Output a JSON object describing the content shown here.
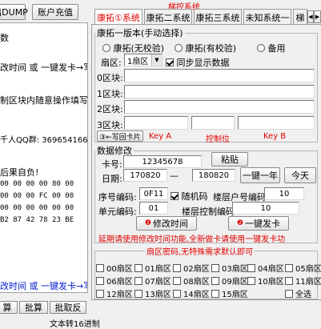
{
  "window": {
    "title": "梯控系统"
  },
  "left_panel": {
    "buttons": {
      "dump": "出DUMP",
      "recharge": "账户充值"
    },
    "lines": [
      "数",
      "改时间 或 一键发卡→写",
      "制区块内随意操作填写,",
      "千人QQ群: 369654166",
      "后果自负!",
      "00 00 00 00 80 00",
      "00 00 00 FC 00 00",
      "00 00 00 00 00 00",
      "B2 87 42 78 23 BE"
    ],
    "bottom_link": "改时间 或 一键发卡→写",
    "bottom_tabs": [
      "算",
      "批算",
      "批取反"
    ],
    "footer_label": "文本转16进制"
  },
  "tabs": [
    {
      "label": "康拓①系统",
      "active": true
    },
    {
      "label": "康拓二系统",
      "active": false
    },
    {
      "label": "康拓三系统",
      "active": false
    },
    {
      "label": "未知系统一",
      "active": false
    },
    {
      "label": "梯",
      "active": false
    }
  ],
  "tab_scroll": {
    "left": "◀",
    "right": "▶"
  },
  "kt_group": {
    "legend": "康拓一版本(手动选择)",
    "radios": [
      {
        "label": "康拓(无校验)",
        "checked": false
      },
      {
        "label": "康拓(有校验)",
        "checked": false
      },
      {
        "label": "备用",
        "checked": false
      }
    ],
    "sector_label": "扇区:",
    "sector_value": "1扇区",
    "sync_label": "同步显示数据",
    "sync_checked": true,
    "blocks": [
      {
        "label": "0区块:",
        "value": ""
      },
      {
        "label": "1区块:",
        "value": ""
      },
      {
        "label": "2区块:",
        "value": ""
      },
      {
        "label": "3区块:",
        "value": ""
      }
    ],
    "write_button": "③←写回卡片",
    "key_a": "Key A",
    "control": "控制位",
    "key_b": "Key B"
  },
  "data_group": {
    "legend": "数据修改",
    "card_label": "卡号:",
    "card_value": "12345678",
    "paste_button": "粘贴",
    "date_label": "日期:",
    "date_from": "170820",
    "date_dash": "—",
    "date_to": "180820",
    "one_year_button": "一键一年",
    "today_button": "今天",
    "seq_label": "序号编码:",
    "seq_value": "0F11",
    "random_label": "随机码",
    "random_checked": true,
    "floor_account_label": "楼层户号编码:",
    "floor_account_value": "10",
    "unit_label": "单元编码:",
    "unit_value": "01",
    "floor_control_label": "楼层控制编码:",
    "floor_control_value": "10",
    "modify_button": "修改时间",
    "issue_button": "一键发卡",
    "notice": "延期请使用修改时间功能,全新做卡请使用一键发卡功"
  },
  "sector_group": {
    "legend": "扇区密码,无特殊需求默认即可",
    "items": [
      "00扇区",
      "01扇区",
      "02扇区",
      "03扇区",
      "04扇区",
      "05扇区",
      "06扇区",
      "07扇区",
      "08扇区",
      "09扇区",
      "10扇区",
      "11扇区",
      "12扇区",
      "13扇区",
      "14扇区",
      "15扇区"
    ],
    "select_all": "全选"
  }
}
